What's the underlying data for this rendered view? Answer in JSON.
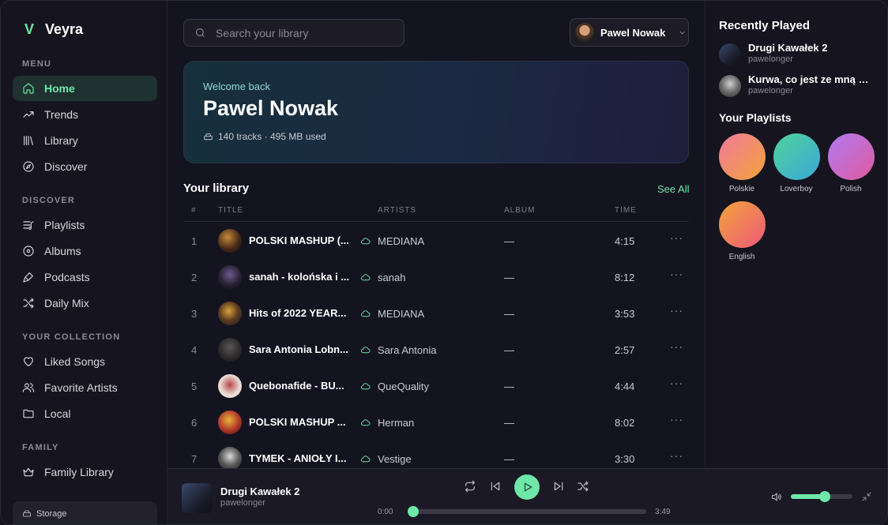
{
  "brand": {
    "logo": "V",
    "name": "Veyra"
  },
  "sidebar": {
    "sections": [
      {
        "title": "MENU",
        "items": [
          {
            "label": "Home",
            "icon": "home-icon",
            "active": true
          },
          {
            "label": "Trends",
            "icon": "trend-icon"
          },
          {
            "label": "Library",
            "icon": "library-icon"
          },
          {
            "label": "Discover",
            "icon": "compass-icon"
          }
        ]
      },
      {
        "title": "DISCOVER",
        "items": [
          {
            "label": "Playlists",
            "icon": "playlist-icon"
          },
          {
            "label": "Albums",
            "icon": "disc-icon"
          },
          {
            "label": "Podcasts",
            "icon": "mic-icon"
          },
          {
            "label": "Daily Mix",
            "icon": "shuffle-icon"
          }
        ]
      },
      {
        "title": "YOUR COLLECTION",
        "items": [
          {
            "label": "Liked Songs",
            "icon": "heart-icon"
          },
          {
            "label": "Favorite Artists",
            "icon": "users-icon"
          },
          {
            "label": "Local",
            "icon": "folder-icon"
          }
        ]
      },
      {
        "title": "FAMILY",
        "items": [
          {
            "label": "Family Library",
            "icon": "crown-icon"
          }
        ]
      }
    ],
    "storage_label": "Storage"
  },
  "search": {
    "placeholder": "Search your library"
  },
  "user": {
    "name": "Pawel Nowak"
  },
  "hero": {
    "welcome": "Welcome back",
    "name": "Pawel Nowak",
    "stats": "140 tracks · 495 MB used"
  },
  "library": {
    "title": "Your library",
    "see_all": "See All",
    "columns": {
      "num": "#",
      "title": "TITLE",
      "artists": "ARTISTS",
      "album": "ALBUM",
      "time": "TIME"
    },
    "rows": [
      {
        "num": "1",
        "title": "POLSKI MASHUP (...",
        "artist": "MEDIANA",
        "album": "—",
        "time": "4:15",
        "more": "···"
      },
      {
        "num": "2",
        "title": "sanah - kolońska i ...",
        "artist": "sanah",
        "album": "—",
        "time": "8:12",
        "more": "···"
      },
      {
        "num": "3",
        "title": "Hits of 2022 YEAR...",
        "artist": "MEDIANA",
        "album": "—",
        "time": "3:53",
        "more": "···"
      },
      {
        "num": "4",
        "title": "Sara Antonia Lobn...",
        "artist": "Sara Antonia",
        "album": "—",
        "time": "2:57",
        "more": "···"
      },
      {
        "num": "5",
        "title": "Quebonafide - BU...",
        "artist": "QueQuality",
        "album": "—",
        "time": "4:44",
        "more": "···"
      },
      {
        "num": "6",
        "title": "POLSKI MASHUP ...",
        "artist": "Herman",
        "album": "—",
        "time": "8:02",
        "more": "···"
      },
      {
        "num": "7",
        "title": "TYMEK - ANIOŁY I...",
        "artist": "Vestige",
        "album": "—",
        "time": "3:30",
        "more": "···"
      }
    ]
  },
  "right": {
    "recent_title": "Recently Played",
    "recent": [
      {
        "title": "Drugi Kawałek 2",
        "artist": "pawelonger"
      },
      {
        "title": "Kurwa, co jest ze mną ni...",
        "artist": "pawelonger"
      }
    ],
    "playlists_title": "Your Playlists",
    "playlists": [
      {
        "label": "Polskie"
      },
      {
        "label": "Loverboy"
      },
      {
        "label": "Polish"
      },
      {
        "label": "English"
      }
    ]
  },
  "player": {
    "title": "Drugi Kawałek 2",
    "artist": "pawelonger",
    "current_time": "0:00",
    "total_time": "3:49",
    "progress": 0.0,
    "volume": 0.55
  },
  "colors": {
    "accent": "#6ee7a8",
    "background": "#141320"
  }
}
